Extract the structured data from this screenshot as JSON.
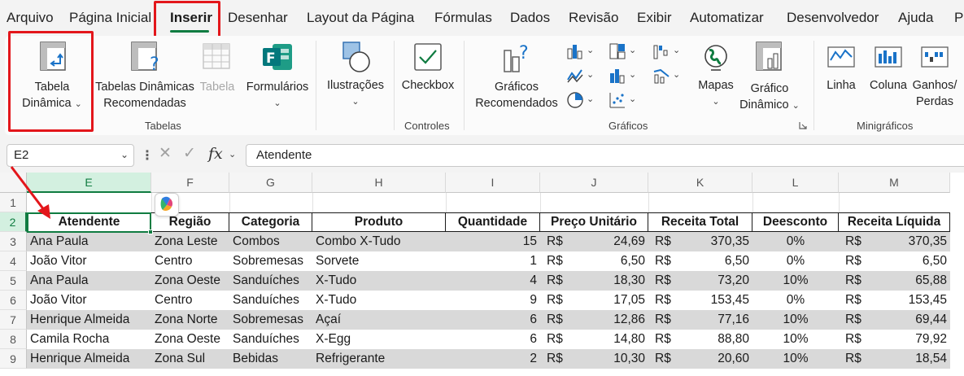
{
  "menu_tabs": [
    "Arquivo",
    "Página Inicial",
    "Inserir",
    "Desenhar",
    "Layout da Página",
    "Fórmulas",
    "Dados",
    "Revisão",
    "Exibir",
    "Automatizar",
    "Desenvolvedor",
    "Ajuda",
    "Po"
  ],
  "active_tab": "Inserir",
  "ribbon": {
    "tabelas": {
      "group_label": "Tabelas",
      "tabela_dinamica": [
        "Tabela",
        "Dinâmica"
      ],
      "tabelas_recomendadas": [
        "Tabelas Dinâmicas",
        "Recomendadas"
      ],
      "tabela": "Tabela",
      "formularios": "Formulários"
    },
    "ilustracoes": "Ilustrações",
    "controles": {
      "group_label": "Controles",
      "checkbox": "Checkbox"
    },
    "graficos": {
      "group_label": "Gráficos",
      "recomendados": [
        "Gráficos",
        "Recomendados"
      ],
      "mapas": "Mapas",
      "grafico_dinamico": [
        "Gráfico",
        "Dinâmico"
      ]
    },
    "minigraficos": {
      "group_label": "Minigráficos",
      "linha": "Linha",
      "coluna": "Coluna",
      "ganhos_perdas": [
        "Ganhos/",
        "Perdas"
      ]
    }
  },
  "formula_bar": {
    "name_box": "E2",
    "fx": "fx",
    "formula": "Atendente"
  },
  "grid": {
    "columns": [
      "E",
      "F",
      "G",
      "H",
      "I",
      "J",
      "K",
      "L",
      "M"
    ],
    "row_numbers": [
      "1",
      "2",
      "3",
      "4",
      "5",
      "6",
      "7",
      "8",
      "9"
    ],
    "headers": [
      "Atendente",
      "Região",
      "Categoria",
      "Produto",
      "Quantidade",
      "Preço Unitário",
      "Receita Total",
      "Deesconto",
      "Receita Líquida"
    ],
    "currency": "R$",
    "rows": [
      [
        "Ana Paula",
        "Zona Leste",
        "Combos",
        "Combo X-Tudo",
        "15",
        "24,69",
        "370,35",
        "0%",
        "370,35"
      ],
      [
        "João Vitor",
        "Centro",
        "Sobremesas",
        "Sorvete",
        "1",
        "6,50",
        "6,50",
        "0%",
        "6,50"
      ],
      [
        "Ana Paula",
        "Zona Oeste",
        "Sanduíches",
        "X-Tudo",
        "4",
        "18,30",
        "73,20",
        "10%",
        "65,88"
      ],
      [
        "João Vitor",
        "Centro",
        "Sanduíches",
        "X-Tudo",
        "9",
        "17,05",
        "153,45",
        "0%",
        "153,45"
      ],
      [
        "Henrique Almeida",
        "Zona Norte",
        "Sobremesas",
        "Açaí",
        "6",
        "12,86",
        "77,16",
        "10%",
        "69,44"
      ],
      [
        "Camila Rocha",
        "Zona Oeste",
        "Sanduíches",
        "X-Egg",
        "6",
        "14,80",
        "88,80",
        "10%",
        "79,92"
      ],
      [
        "Henrique Almeida",
        "Zona Sul",
        "Bebidas",
        "Refrigerante",
        "2",
        "10,30",
        "20,60",
        "10%",
        "18,54"
      ]
    ]
  },
  "colors": {
    "excel_green": "#107c41",
    "highlight_red": "#e3161b",
    "band_gray": "#d9d9d9"
  }
}
